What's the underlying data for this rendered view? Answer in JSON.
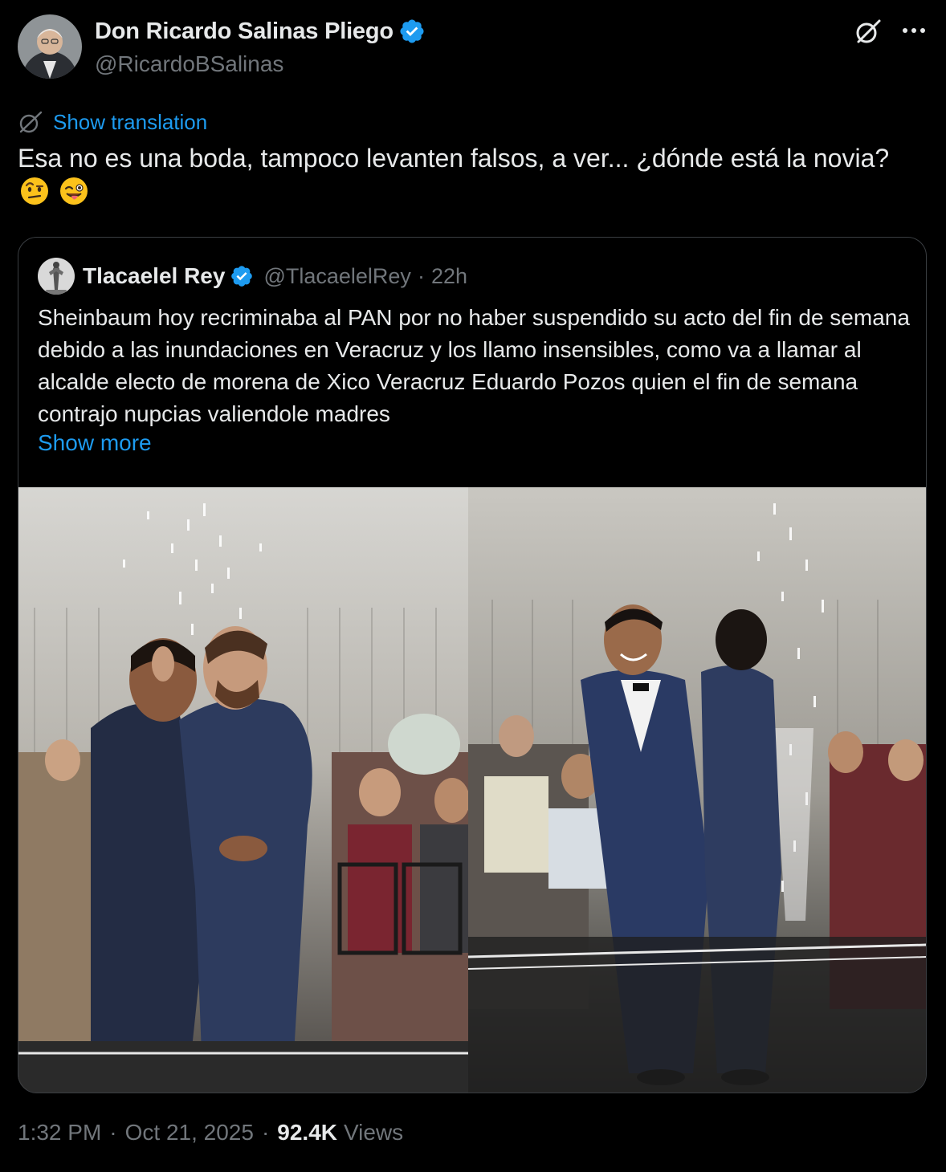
{
  "tweet": {
    "author_name": "Don Ricardo Salinas Pliego",
    "author_handle": "@RicardoBSalinas",
    "translate_label": "Show translation",
    "text": "Esa no es una boda, tampoco levanten falsos, a ver... ¿dónde está la novia?",
    "emojis": [
      "face-with-raised-eyebrow-emoji",
      "winking-face-with-tongue-emoji"
    ],
    "icons": {
      "verified": "verified-badge-icon",
      "grok": "grok-icon",
      "more": "more-options-icon",
      "translate": "translate-icon"
    },
    "colors": {
      "background": "#000000",
      "accent": "#1d9bf0",
      "text": "#e7e9ea",
      "muted": "#71767b"
    }
  },
  "quoted": {
    "author_name": "Tlacaelel Rey",
    "author_handle": "@TlacaelelRey",
    "separator": "·",
    "time": "22h",
    "text": "Sheinbaum hoy recriminaba al PAN por no haber suspendido su acto del fin de semana debido a las inundaciones en Veracruz y los llamo insensibles, como va a llamar al alcalde electo de morena de Xico Veracruz Eduardo Pozos quien el fin de semana contrajo nupcias valiendole madres",
    "show_more": "Show more",
    "media": [
      "wedding-photo-embrace",
      "wedding-photo-standing"
    ]
  },
  "footer": {
    "time": "1:32 PM",
    "separator_1": "·",
    "date": "Oct 21, 2025",
    "separator_2": "·",
    "views_count": "92.4K",
    "views_label": "Views"
  }
}
